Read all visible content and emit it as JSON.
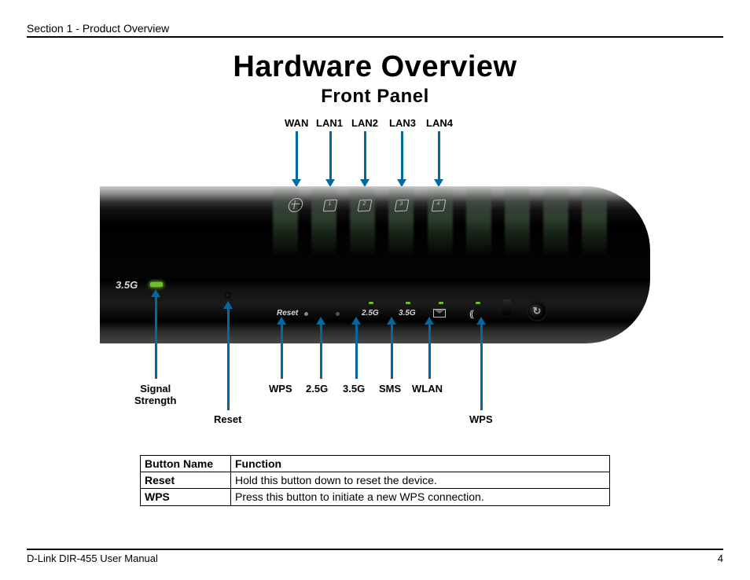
{
  "header": {
    "section": "Section 1 - Product Overview"
  },
  "title": {
    "main": "Hardware Overview",
    "sub": "Front Panel"
  },
  "top_labels": {
    "wan": "WAN",
    "lan1": "LAN1",
    "lan2": "LAN2",
    "lan3": "LAN3",
    "lan4": "LAN4"
  },
  "bottom_labels": {
    "signal": "Signal\nStrength",
    "reset": "Reset",
    "wps_led": "WPS",
    "g25": "2.5G",
    "g35": "3.5G",
    "sms": "SMS",
    "wlan": "WLAN",
    "wps_btn": "WPS"
  },
  "router": {
    "strength_label": "3.5G",
    "reset_label": "Reset",
    "g25_label": "2.5G",
    "g35_label": "3.5G",
    "lan_nums": {
      "n1": "1",
      "n2": "2",
      "n3": "3",
      "n4": "4"
    }
  },
  "table": {
    "header": {
      "name": "Button Name",
      "func": "Function"
    },
    "rows": {
      "reset": {
        "name": "Reset",
        "func": "Hold this button down to reset the device."
      },
      "wps": {
        "name": "WPS",
        "func": "Press this button to initiate a new WPS connection."
      }
    }
  },
  "footer": {
    "left": "D-Link DIR-455 User Manual",
    "page": "4"
  }
}
